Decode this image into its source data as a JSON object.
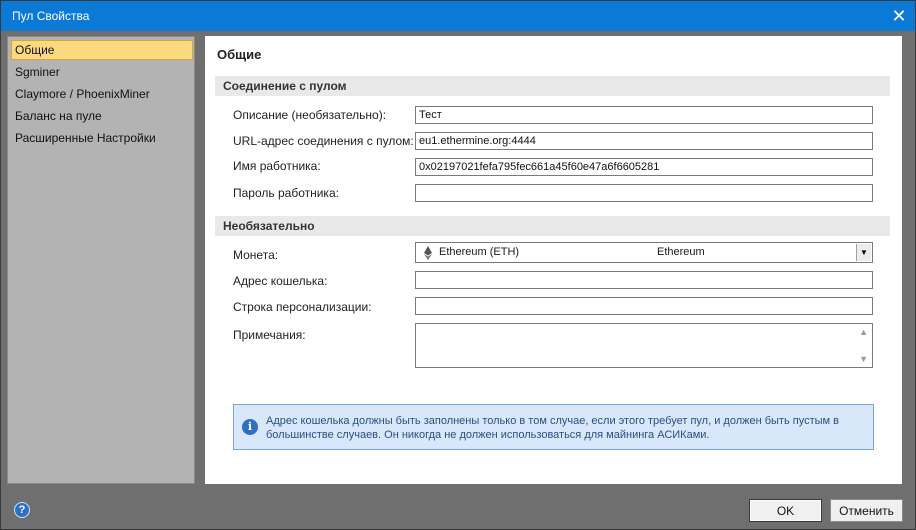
{
  "window": {
    "title": "Пул Свойства"
  },
  "sidebar": {
    "items": [
      {
        "label": "Общие"
      },
      {
        "label": "Sgminer"
      },
      {
        "label": "Claymore / PhoenixMiner"
      },
      {
        "label": "Баланс на пуле"
      },
      {
        "label": "Расширенные Настройки"
      }
    ]
  },
  "page": {
    "title": "Общие",
    "section_connection": "Соединение с пулом",
    "section_optional": "Необязательно"
  },
  "fields": {
    "description": {
      "label": "Описание (необязательно):",
      "value": "Тест"
    },
    "url": {
      "label": "URL-адрес соединения с пулом:",
      "value": "eu1.ethermine.org:4444"
    },
    "worker": {
      "label": "Имя работника:",
      "value": "0x02197021fefa795fec661a45f60e47a6f6605281"
    },
    "password": {
      "label": "Пароль работника:",
      "value": ""
    },
    "coin": {
      "label": "Монета:",
      "symbol_text": "Ethereum (ETH)",
      "name_text": "Ethereum"
    },
    "wallet": {
      "label": "Адрес кошелька:",
      "value": ""
    },
    "personalization": {
      "label": "Строка персонализации:",
      "value": ""
    },
    "notes": {
      "label": "Примечания:",
      "value": ""
    }
  },
  "info": {
    "text": "Адрес кошелька должны быть заполнены только в том случае, если этого требует пул, и должен быть пустым в большинстве случаев. Он никогда не должен использоваться для майнинга АСИКами."
  },
  "footer": {
    "ok_label": "OK",
    "cancel_label": "Отменить"
  },
  "icons": {
    "close": "close-icon",
    "help": "help-icon",
    "info": "info-icon",
    "coin": "ethereum-icon"
  },
  "colors": {
    "titlebar": "#0a7ad6",
    "selection": "#fbd981",
    "info_bg": "#d8e8fa"
  }
}
